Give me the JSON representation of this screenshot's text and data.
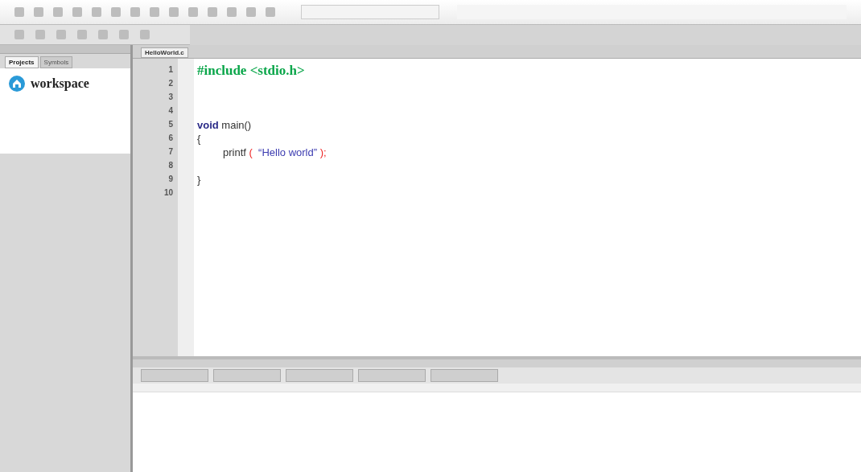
{
  "workspace_panel": {
    "tabs": [
      {
        "label": "Projects",
        "selected": true
      },
      {
        "label": "Symbols",
        "selected": false
      }
    ],
    "tree": [
      {
        "label": "workspace"
      }
    ]
  },
  "editor": {
    "tabs": [
      {
        "label": "HelloWorld.c",
        "selected": true
      }
    ],
    "lines": [
      {
        "number": "1",
        "tokens": [
          {
            "kind": "preprocessor",
            "text": "#include <stdio.h>"
          }
        ]
      },
      {
        "number": "2"
      },
      {
        "number": "3"
      },
      {
        "number": "4"
      },
      {
        "number": "5",
        "tokens": [
          {
            "kind": "keyword",
            "text": "void"
          },
          {
            "kind": "plain",
            "text": " main()"
          }
        ]
      },
      {
        "number": "6",
        "tokens": [
          {
            "kind": "plain",
            "text": "{"
          }
        ]
      },
      {
        "number": "7",
        "indented": true,
        "tokens": [
          {
            "kind": "plain",
            "text": "printf "
          },
          {
            "kind": "punct",
            "text": "( "
          },
          {
            "kind": "string",
            "text": " “Hello world” "
          },
          {
            "kind": "punct",
            "text": ");"
          }
        ]
      },
      {
        "number": "8"
      },
      {
        "number": "9",
        "tokens": [
          {
            "kind": "plain",
            "text": "}"
          }
        ]
      },
      {
        "number": "10"
      }
    ]
  }
}
